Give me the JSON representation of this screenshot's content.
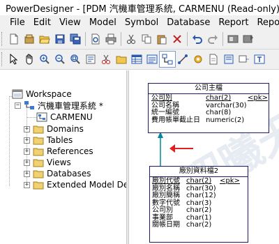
{
  "window": {
    "title": "PowerDesigner - [PDM 汽機車管理系統, CARMENU (Read-only)]"
  },
  "menu": [
    "File",
    "Edit",
    "View",
    "Model",
    "Symbol",
    "Database",
    "Report",
    "Repo"
  ],
  "toolbar1": [
    "new-icon",
    "open-project-icon",
    "open-icon",
    "save-icon",
    "save-all-icon",
    "print-preview-icon",
    "print-icon",
    "cut-icon",
    "copy-icon",
    "paste-icon",
    "delete-icon",
    "undo-icon",
    "redo-icon",
    "repository-icon",
    "repository-update-icon"
  ],
  "toolbar2": [
    "pointer-icon",
    "hand-icon",
    "zoom-in-icon",
    "zoom-out-icon",
    "zoom-fit-icon",
    "properties-icon",
    "scissors-tool-icon",
    "package-icon",
    "table-icon",
    "view-icon",
    "reference-icon",
    "link-icon",
    "procedure-icon",
    "file-icon",
    "note-icon",
    "note-link-icon",
    "text-icon"
  ],
  "tree": {
    "workspace": "Workspace",
    "model": "汽機車管理系統 *",
    "diagram": "CARMENU",
    "folders": [
      "Domains",
      "Tables",
      "References",
      "Views",
      "Databases",
      "Extended Model De"
    ]
  },
  "diagram": {
    "watermark": "昭曦天翼",
    "arrow_color": "#e02020",
    "table1": {
      "name": "公司主檔",
      "columns": [
        {
          "name": "公司別",
          "type": "char(2)",
          "key": "<pk>",
          "pk": true
        },
        {
          "name": "公司名稱",
          "type": "varchar(30)",
          "key": "",
          "pk": false
        },
        {
          "name": "統一編號",
          "type": "char(8)",
          "key": "",
          "pk": false
        },
        {
          "name": "費用帳單截止日",
          "type": "numeric(2)",
          "key": "",
          "pk": false
        }
      ]
    },
    "table2": {
      "name": "廠別資料檔2",
      "columns": [
        {
          "name": "廠別代號",
          "type": "char(2)",
          "key": "<pk>",
          "pk": true
        },
        {
          "name": "廠別名稱",
          "type": "char(30)",
          "key": "",
          "pk": false
        },
        {
          "name": "廠別簡稱",
          "type": "char(12)",
          "key": "",
          "pk": false
        },
        {
          "name": "數字代號",
          "type": "char(3)",
          "key": "",
          "pk": false
        },
        {
          "name": "公司別",
          "type": "char(2)",
          "key": "",
          "pk": false
        },
        {
          "name": "事業部",
          "type": "char(1)",
          "key": "",
          "pk": false
        },
        {
          "name": "關帳日期",
          "type": "char(2)",
          "key": "",
          "pk": false
        }
      ]
    }
  }
}
